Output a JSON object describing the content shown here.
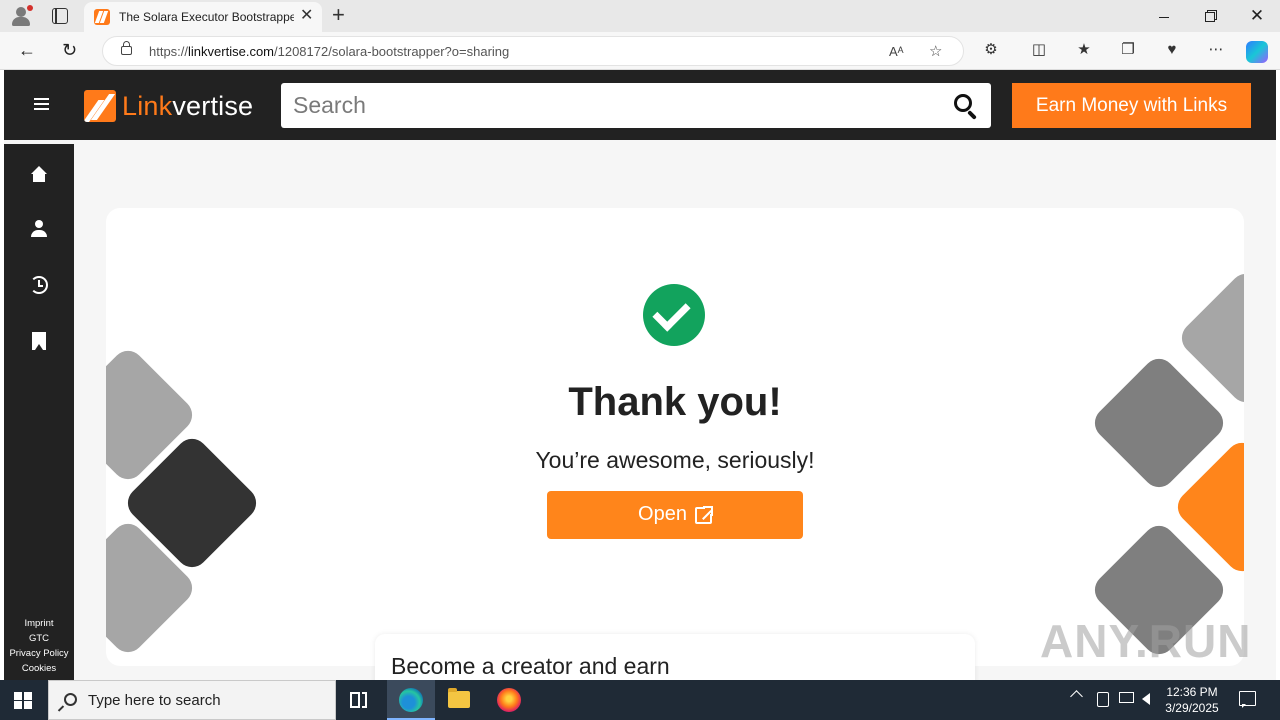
{
  "browser": {
    "tab_title": "The Solara Executor Bootstrapper",
    "tab_close": "✕",
    "new_tab": "+",
    "url_scheme": "https://",
    "url_host": "linkvertise.com",
    "url_path": "/1208172/solara-bootstrapper?o=sharing",
    "read_aloud": "Aᴬ",
    "window_close": "✕"
  },
  "site": {
    "logo_link": "Link",
    "logo_vertise": "vertise",
    "search_placeholder": "Search",
    "earn_button": "Earn Money with Links",
    "footer_links": [
      "Imprint",
      "GTC",
      "Privacy Policy",
      "Cookies"
    ]
  },
  "main": {
    "title": "Thank you!",
    "subtitle": "You’re awesome, seriously!",
    "open_button": "Open",
    "creator_title": "Become a creator and earn"
  },
  "watermark": "ANY.RUN",
  "taskbar": {
    "search_placeholder": "Type here to search",
    "time": "12:36 PM",
    "date": "3/29/2025"
  },
  "colors": {
    "accent": "#ff851b",
    "header_bg": "#222222",
    "success": "#12a35d"
  },
  "icons": [
    "profile-icon",
    "tab-actions-icon",
    "back-icon",
    "reload-icon",
    "lock-icon",
    "read-aloud-icon",
    "favorite-star-icon",
    "extensions-icon",
    "split-screen-icon",
    "favorites-icon",
    "collections-icon",
    "performance-icon",
    "more-icon",
    "copilot-icon",
    "menu-icon",
    "search-icon",
    "home-icon",
    "user-icon",
    "history-icon",
    "bookmark-icon",
    "check-icon",
    "external-link-icon",
    "windows-start-icon",
    "task-view-icon",
    "edge-icon",
    "file-explorer-icon",
    "firefox-icon",
    "notification-icon"
  ]
}
